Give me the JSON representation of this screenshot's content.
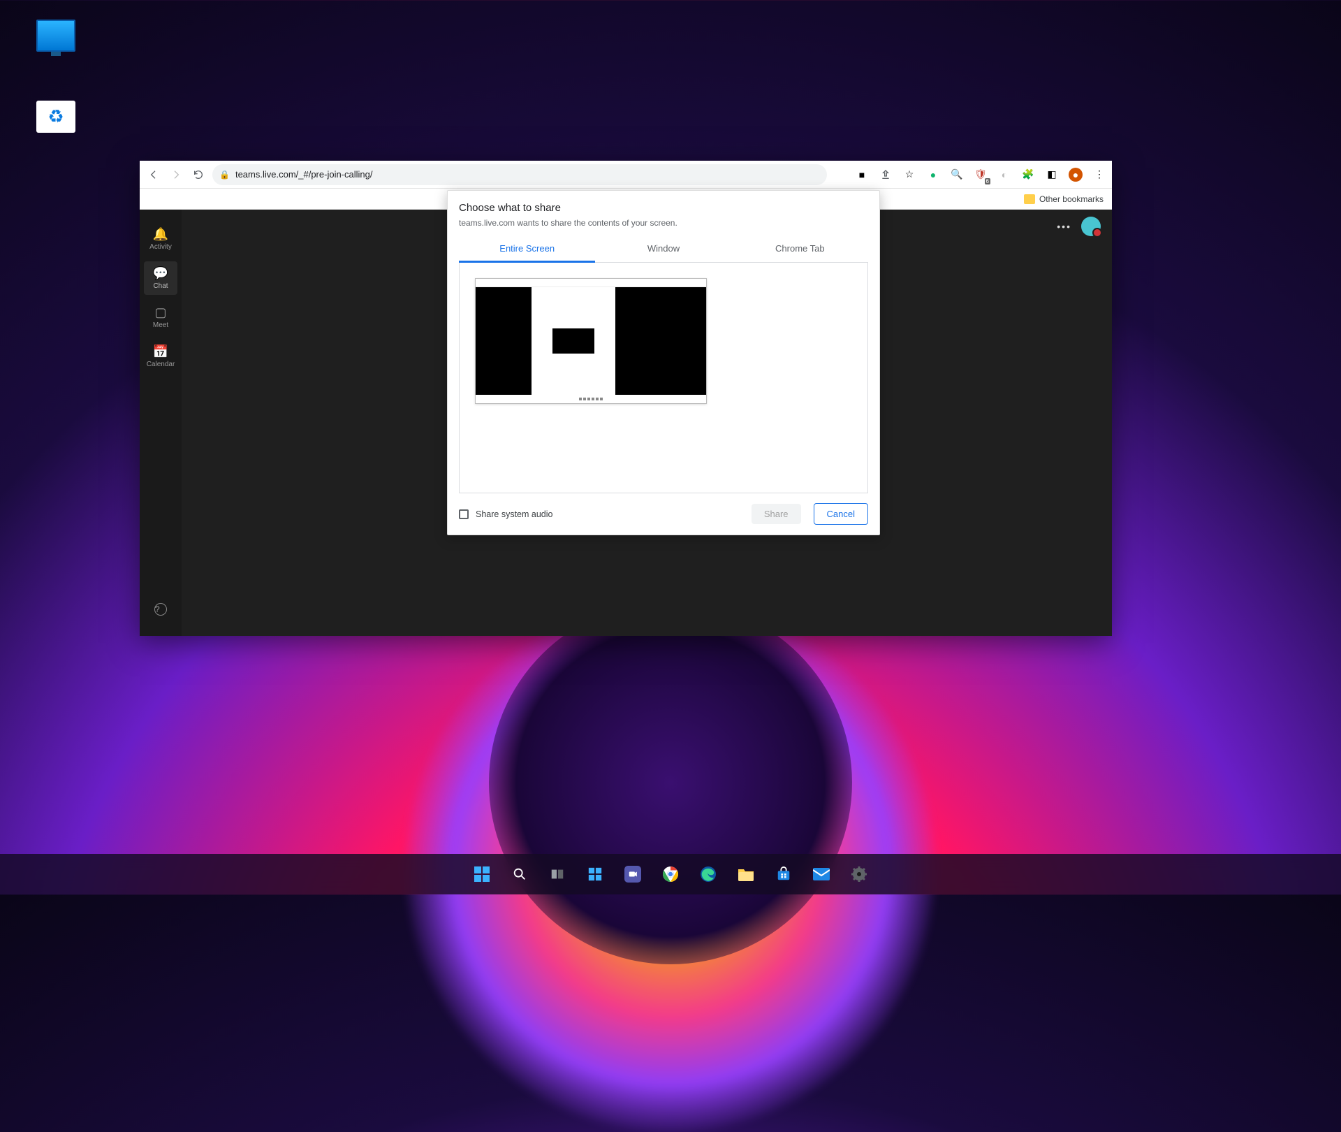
{
  "chrome": {
    "url": "teams.live.com/_#/pre-join-calling/",
    "bookmarks_label": "Other bookmarks"
  },
  "teams_sidebar": {
    "items": [
      {
        "icon": "🔔",
        "label": "Activity"
      },
      {
        "icon": "💬",
        "label": "Chat"
      },
      {
        "icon": "▢",
        "label": "Meet"
      },
      {
        "icon": "📅",
        "label": "Calendar"
      }
    ],
    "help_icon": "?"
  },
  "dialog": {
    "title": "Choose what to share",
    "subtitle": "teams.live.com wants to share the contents of your screen.",
    "tabs": {
      "entire": "Entire Screen",
      "window": "Window",
      "chrometab": "Chrome Tab"
    },
    "audio_label": "Share system audio",
    "share": "Share",
    "cancel": "Cancel"
  },
  "taskbar": {
    "items": [
      {
        "name": "start"
      },
      {
        "name": "search"
      },
      {
        "name": "task-view"
      },
      {
        "name": "widgets"
      },
      {
        "name": "teams"
      },
      {
        "name": "chrome"
      },
      {
        "name": "edge"
      },
      {
        "name": "explorer"
      },
      {
        "name": "store"
      },
      {
        "name": "mail"
      },
      {
        "name": "settings"
      }
    ]
  }
}
